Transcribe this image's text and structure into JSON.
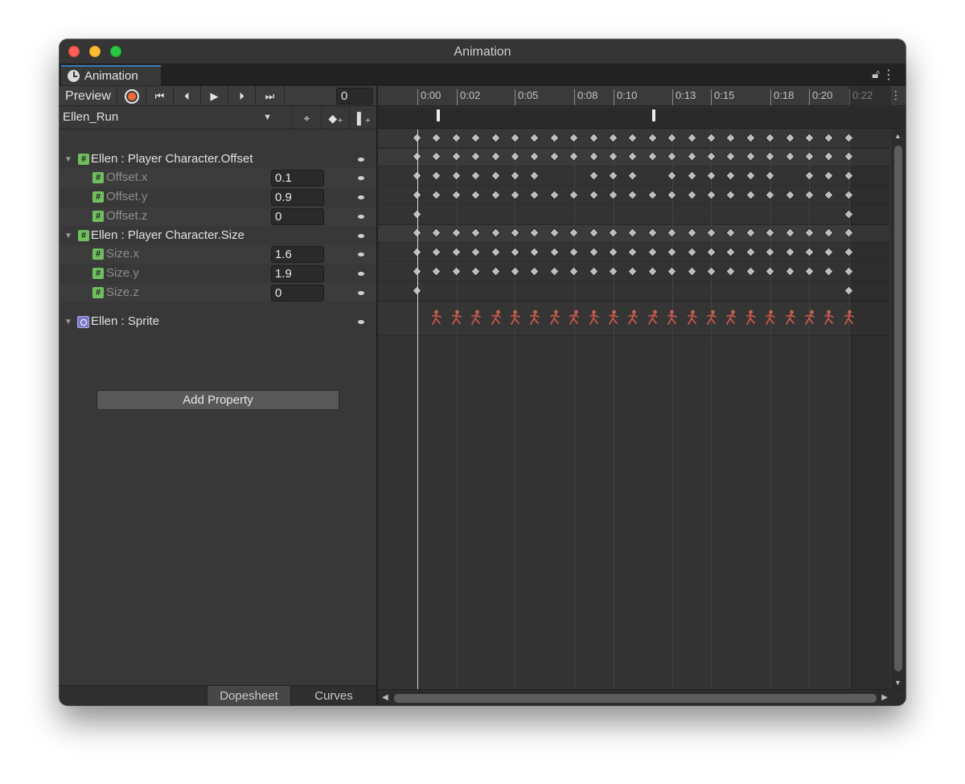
{
  "window": {
    "title": "Animation",
    "tab_label": "Animation"
  },
  "toolbar": {
    "preview_label": "Preview",
    "frame_value": "0"
  },
  "clip": {
    "name": "Ellen_Run"
  },
  "properties": {
    "offset_group": "Ellen : Player Character.Offset",
    "offset_x": {
      "label": "Offset.x",
      "value": "0.1"
    },
    "offset_y": {
      "label": "Offset.y",
      "value": "0.9"
    },
    "offset_z": {
      "label": "Offset.z",
      "value": "0"
    },
    "size_group": "Ellen : Player Character.Size",
    "size_x": {
      "label": "Size.x",
      "value": "1.6"
    },
    "size_y": {
      "label": "Size.y",
      "value": "1.9"
    },
    "size_z": {
      "label": "Size.z",
      "value": "0"
    },
    "sprite_group": "Ellen : Sprite"
  },
  "add_property_label": "Add Property",
  "bottom_tabs": {
    "dopesheet": "Dopesheet",
    "curves": "Curves"
  },
  "timeline": {
    "ticks": [
      "0:00",
      "0:02",
      "0:05",
      "0:08",
      "0:10",
      "0:13",
      "0:15",
      "0:18",
      "0:20",
      "0:22"
    ],
    "keyframe_count": 23,
    "rows": {
      "summary": [
        0,
        1,
        2,
        3,
        4,
        5,
        6,
        7,
        8,
        9,
        10,
        11,
        12,
        13,
        14,
        15,
        16,
        17,
        18,
        19,
        20,
        21,
        22
      ],
      "offset_group": [
        0,
        1,
        2,
        3,
        4,
        5,
        6,
        7,
        8,
        9,
        10,
        11,
        12,
        13,
        14,
        15,
        16,
        17,
        18,
        19,
        20,
        21,
        22
      ],
      "offset_x": [
        0,
        1,
        2,
        3,
        4,
        5,
        6,
        9,
        10,
        11,
        13,
        14,
        15,
        16,
        17,
        18,
        20,
        21,
        22
      ],
      "offset_y": [
        0,
        1,
        2,
        3,
        4,
        5,
        6,
        7,
        8,
        9,
        10,
        11,
        12,
        13,
        14,
        15,
        16,
        17,
        18,
        19,
        20,
        21,
        22
      ],
      "offset_z": [
        0,
        22
      ],
      "size_group": [
        0,
        1,
        2,
        3,
        4,
        5,
        6,
        7,
        8,
        9,
        10,
        11,
        12,
        13,
        14,
        15,
        16,
        17,
        18,
        19,
        20,
        21,
        22
      ],
      "size_x": [
        0,
        1,
        2,
        3,
        4,
        5,
        6,
        7,
        8,
        9,
        10,
        11,
        12,
        13,
        14,
        15,
        16,
        17,
        18,
        19,
        20,
        21,
        22
      ],
      "size_y": [
        0,
        1,
        2,
        3,
        4,
        5,
        6,
        7,
        8,
        9,
        10,
        11,
        12,
        13,
        14,
        15,
        16,
        17,
        18,
        19,
        20,
        21,
        22
      ],
      "size_z": [
        0,
        22
      ]
    },
    "sprite_frames": 22,
    "event_markers": 2
  },
  "colors": {
    "accent_tab": "#3a79bb",
    "record": "#f06a36",
    "float_icon": "#6fbf5f",
    "sprite_icon": "#7c79c9",
    "keyframe": "#bdbdbd"
  }
}
